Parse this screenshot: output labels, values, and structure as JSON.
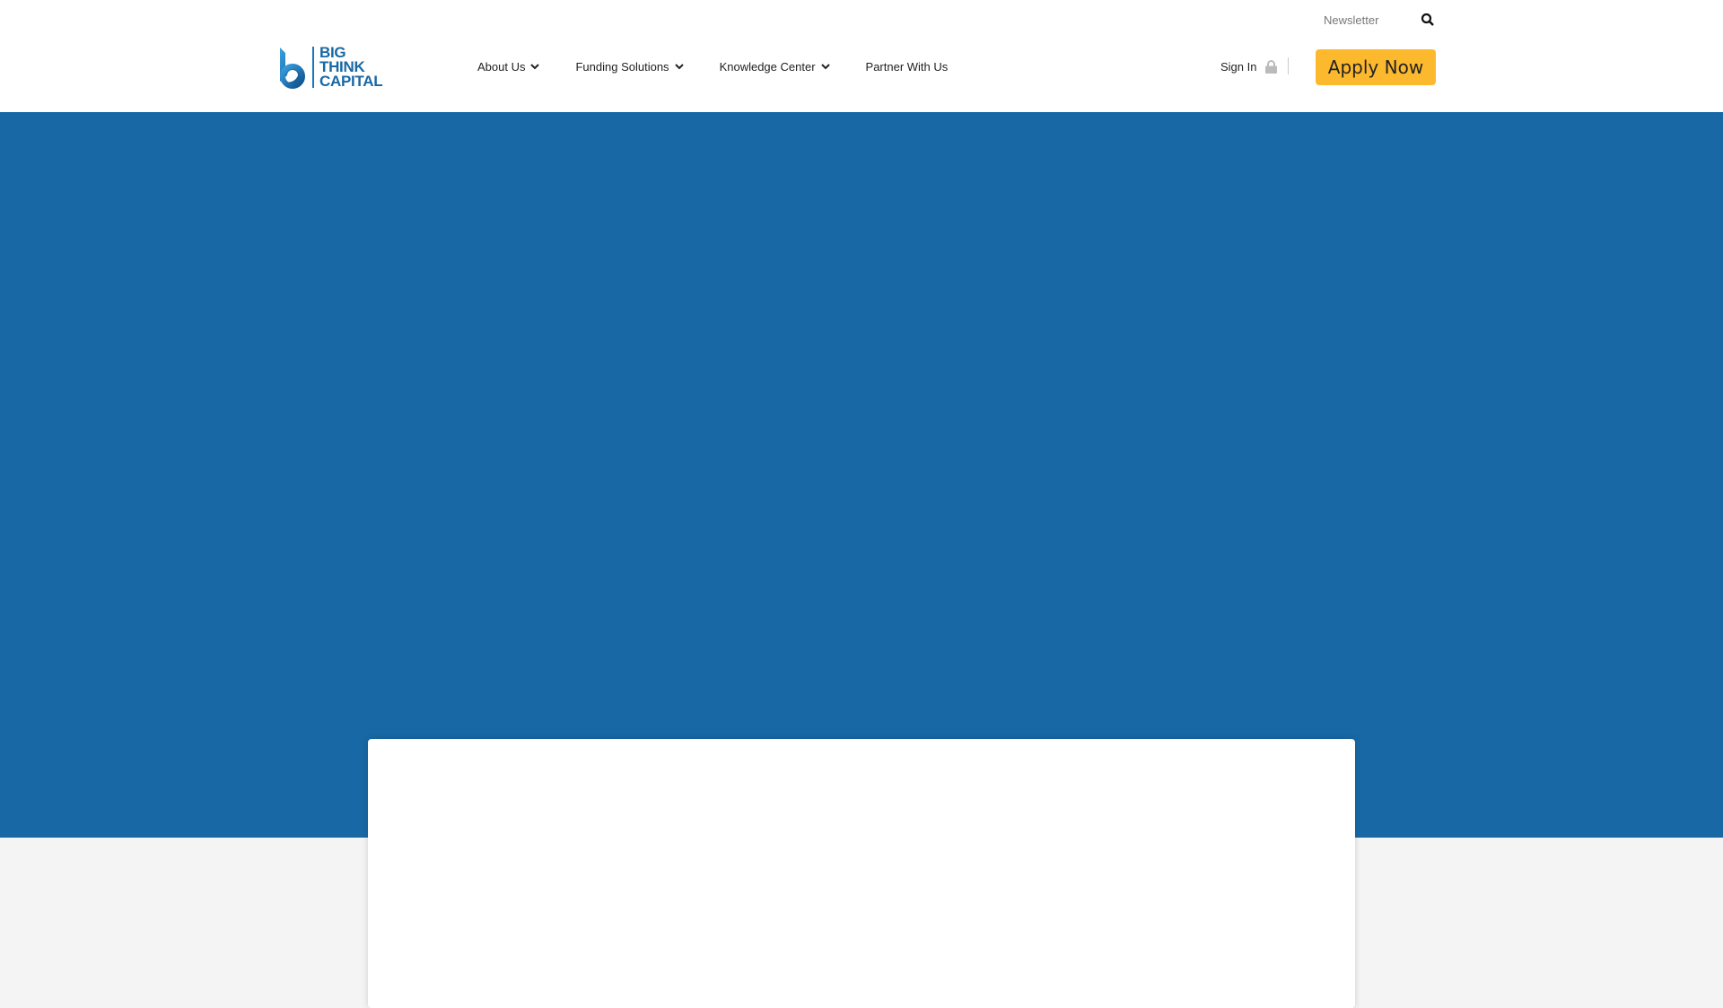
{
  "header": {
    "newsletter": "Newsletter",
    "logo_text": [
      "BIG",
      "THINK",
      "CAPITAL"
    ],
    "nav": [
      {
        "label": "About Us",
        "dropdown": true
      },
      {
        "label": "Funding Solutions",
        "dropdown": true
      },
      {
        "label": "Knowledge Center",
        "dropdown": true
      },
      {
        "label": "Partner With Us",
        "dropdown": false
      }
    ],
    "sign_in": "Sign In",
    "apply": "Apply Now"
  },
  "colors": {
    "brand_blue": "#1868a5",
    "accent": "#fdb92e"
  }
}
